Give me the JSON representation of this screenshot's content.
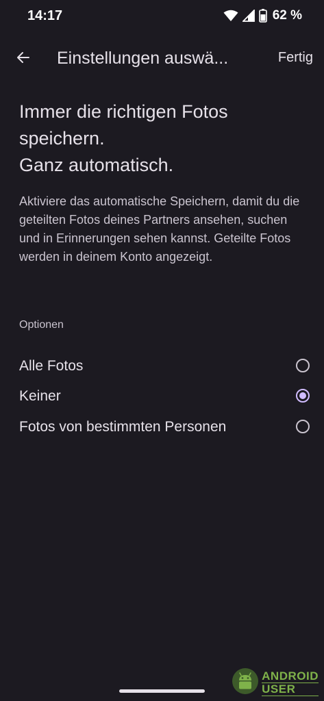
{
  "status_bar": {
    "time": "14:17",
    "battery": "62 %",
    "icons": [
      "wifi-icon",
      "signal-icon",
      "battery-icon"
    ]
  },
  "app_bar": {
    "title": "Einstellungen auswä...",
    "done_label": "Fertig",
    "back_icon": "arrow-back-icon"
  },
  "content": {
    "headline_lines": [
      "Immer die richtigen Fotos",
      "speichern.",
      "Ganz automatisch."
    ],
    "description": "Aktiviere das automatische Speichern, damit du die geteilten Fotos deines Partners ansehen, suchen und in Erinnerungen sehen kannst. Geteilte Fotos werden in deinem Konto angezeigt.",
    "section_label": "Optionen",
    "options": [
      {
        "label": "Alle Fotos",
        "selected": false
      },
      {
        "label": "Keiner",
        "selected": true
      },
      {
        "label": "Fotos von bestimmten Personen",
        "selected": false
      }
    ]
  },
  "watermark": {
    "line1": "ANDROID",
    "line2": "USER"
  },
  "colors": {
    "background": "#1c1a21",
    "text_primary": "#e6e1e9",
    "text_secondary": "#cac4cf",
    "accent": "#d0bcff",
    "watermark_green": "#7fb24a"
  }
}
